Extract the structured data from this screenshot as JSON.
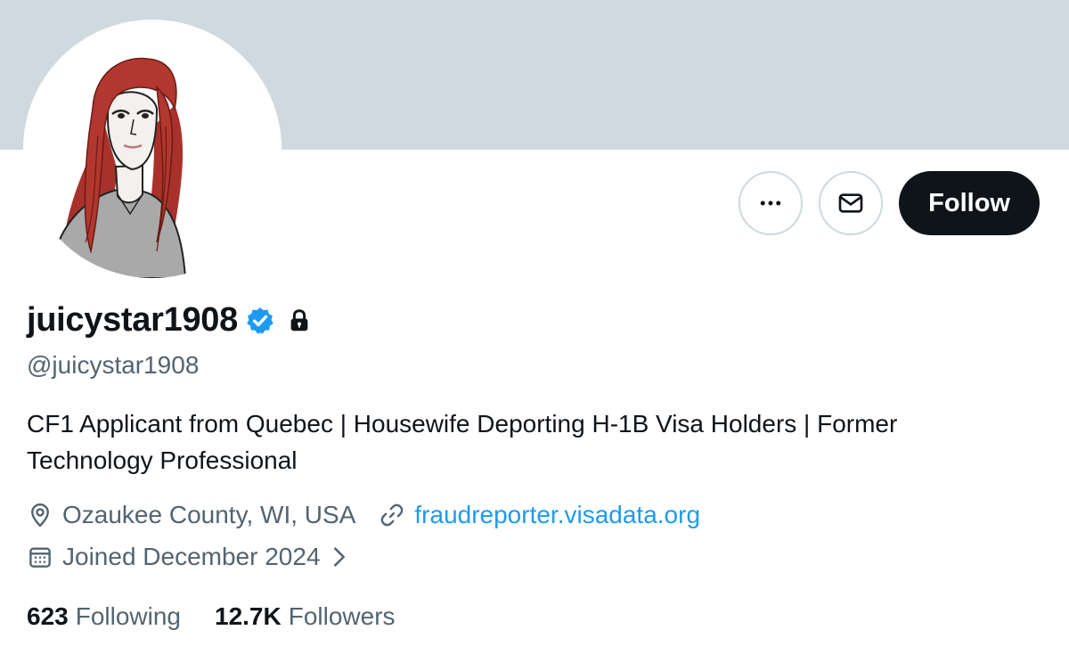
{
  "banner": {
    "color": "#cfd9e0"
  },
  "profile": {
    "display_name": "juicystar1908",
    "handle": "@juicystar1908",
    "verified_color": "#1d9bf0",
    "bio": "CF1 Applicant from Quebec | Housewife Deporting H-1B Visa Holders | Former Technology Professional",
    "location": "Ozaukee County, WI, USA",
    "website": "fraudreporter.visadata.org",
    "joined": "Joined December 2024"
  },
  "actions": {
    "more_icon": "more-horizontal-icon",
    "message_icon": "envelope-icon",
    "follow_label": "Follow"
  },
  "stats": {
    "following_count": "623",
    "following_label": "Following",
    "followers_count": "12.7K",
    "followers_label": "Followers"
  },
  "colors": {
    "link": "#1d9bf0",
    "secondary_text": "#536471",
    "primary_text": "#0f1419"
  }
}
